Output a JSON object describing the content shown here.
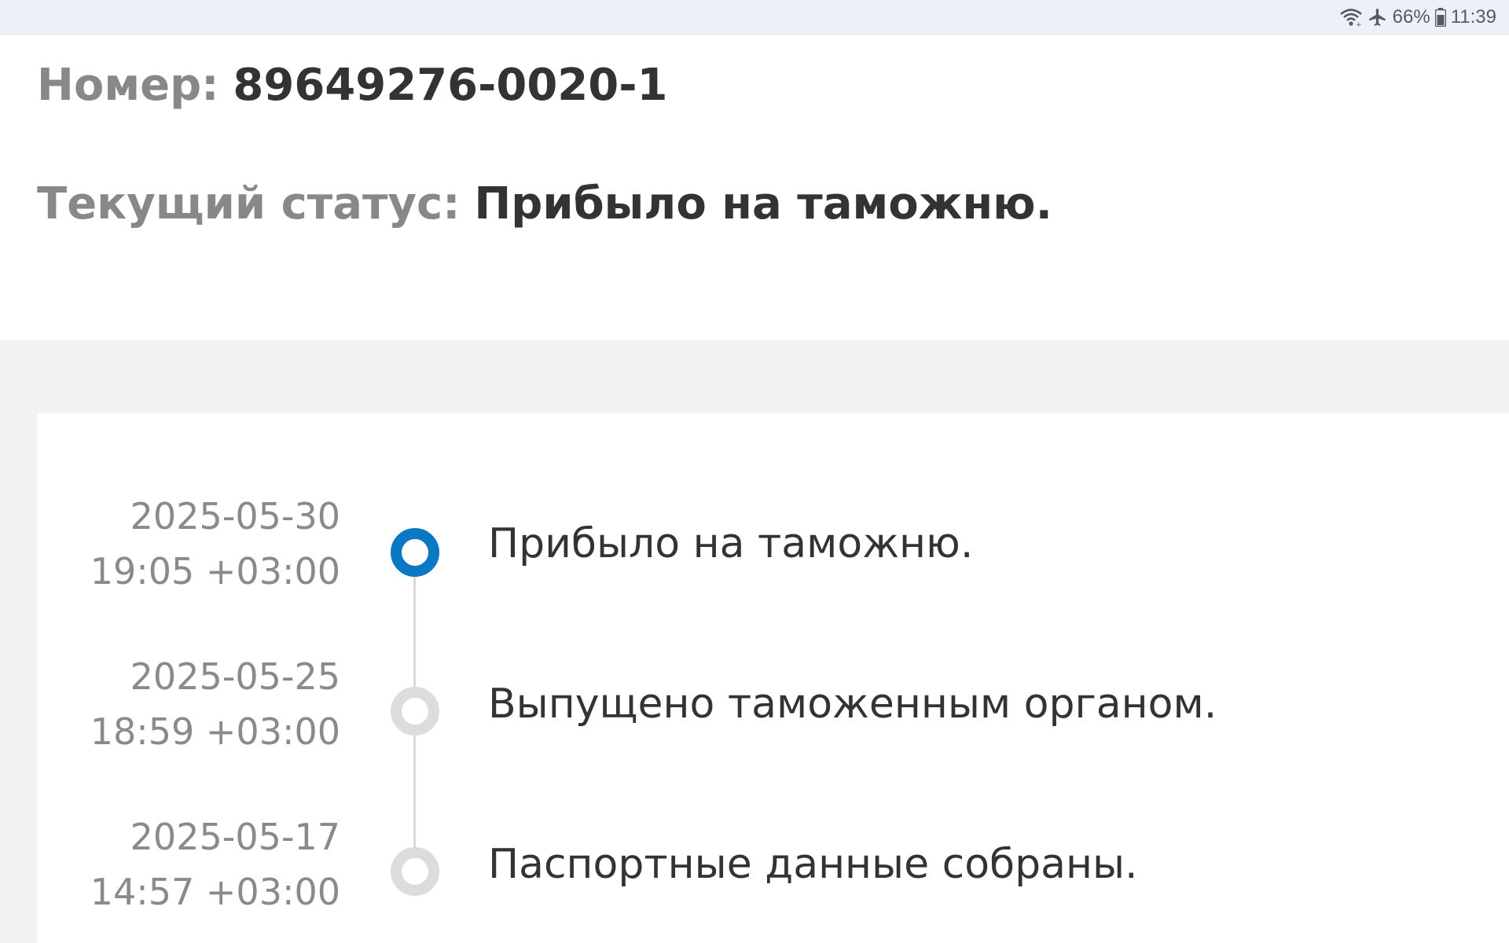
{
  "status_bar": {
    "wifi_icon": "wifi-icon",
    "airplane_icon": "airplane-icon",
    "battery_percent": "66%",
    "battery_icon": "battery-icon",
    "time": "11:39"
  },
  "header": {
    "number_label": "Номер:",
    "number_value": "89649276-0020-1",
    "status_label": "Текущий статус:",
    "status_value": "Прибыло на таможню."
  },
  "timeline": {
    "events": [
      {
        "date": "2025-05-30",
        "time": "19:05 +03:00",
        "text": "Прибыло на таможню.",
        "active": true
      },
      {
        "date": "2025-05-25",
        "time": "18:59 +03:00",
        "text": "Выпущено таможенным органом.",
        "active": false
      },
      {
        "date": "2025-05-17",
        "time": "14:57 +03:00",
        "text": "Паспортные данные собраны.",
        "active": false
      }
    ]
  },
  "colors": {
    "accent": "#0a78c2",
    "inactive_dot": "#dcdcdc",
    "status_bar_bg": "#ecf0fa",
    "page_bg": "#f2f2f2"
  }
}
